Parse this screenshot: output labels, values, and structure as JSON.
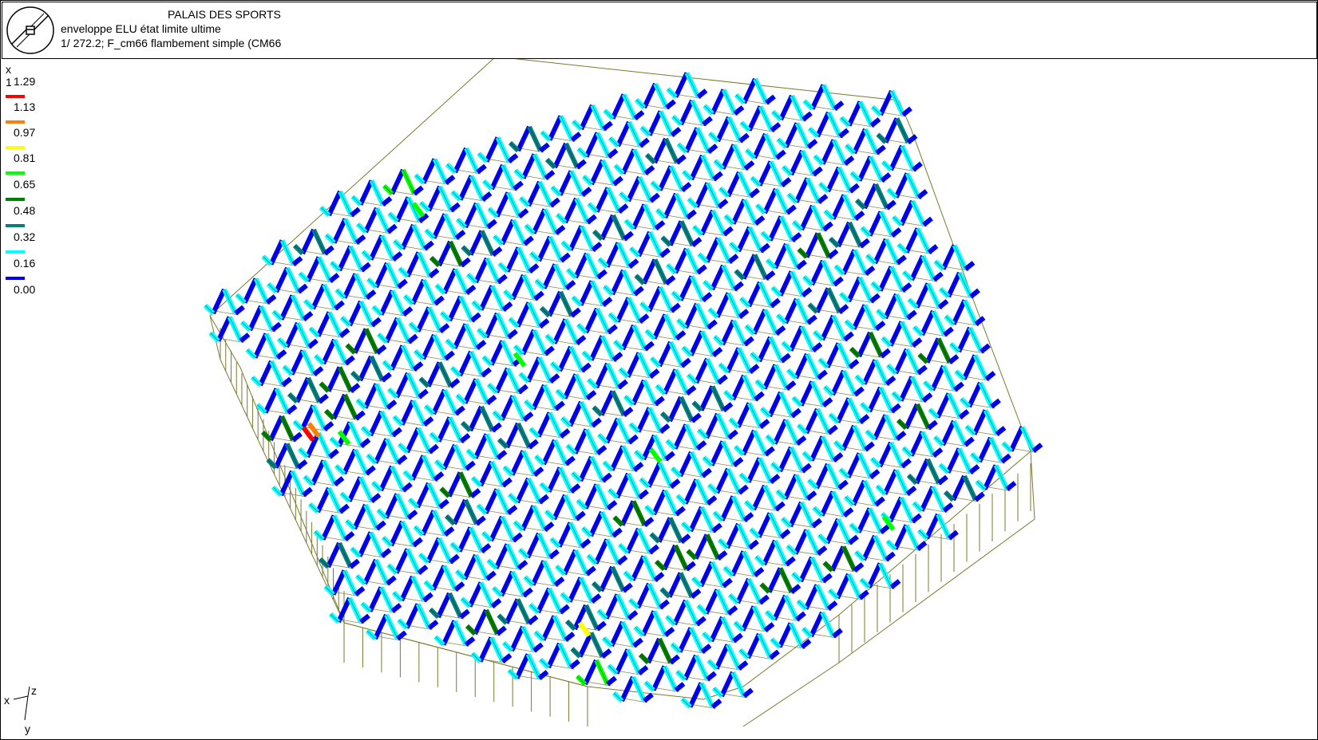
{
  "header": {
    "title": "PALAIS DES SPORTS",
    "subtitle1": "enveloppe ELU état limite ultime",
    "subtitle2": "1/ 272.2; F_cm66 flambement simple (CM66"
  },
  "legend": {
    "scale": "x 1",
    "levels": [
      {
        "value": "1.29",
        "color": null
      },
      {
        "value": "1.13",
        "color": "#ff0000"
      },
      {
        "value": "0.97",
        "color": "#ff8000"
      },
      {
        "value": "0.81",
        "color": "#ffff00"
      },
      {
        "value": "0.65",
        "color": "#00ff00"
      },
      {
        "value": "0.48",
        "color": "#008000"
      },
      {
        "value": "0.32",
        "color": "#008080"
      },
      {
        "value": "0.16",
        "color": "#00ffff"
      },
      {
        "value": "0.00",
        "color": "#0000ff"
      }
    ]
  },
  "structure": {
    "frame_color": "#7a7a30",
    "members_colors": [
      "#0000ff",
      "#00ffff",
      "#008080",
      "#008000",
      "#00ff00"
    ]
  },
  "axes": {
    "x": "x",
    "y": "y",
    "z": "z"
  }
}
